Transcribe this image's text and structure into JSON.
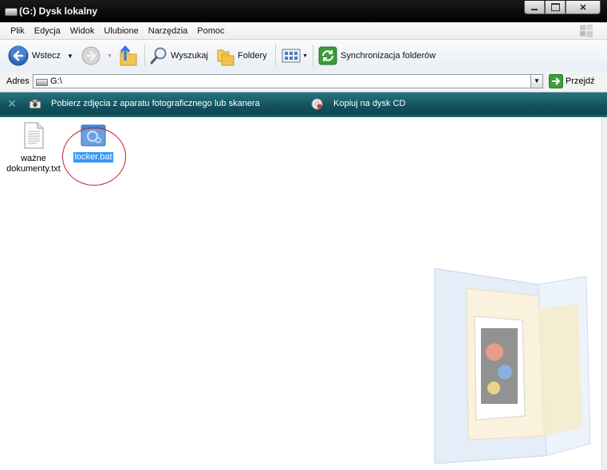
{
  "window": {
    "title": "(G:) Dysk lokalny"
  },
  "menu": {
    "items": [
      "Plik",
      "Edycja",
      "Widok",
      "Ulubione",
      "Narzędzia",
      "Pomoc"
    ]
  },
  "toolbar": {
    "back_label": "Wstecz",
    "search_label": "Wyszukaj",
    "folders_label": "Foldery",
    "sync_label": "Synchronizacja folderów"
  },
  "address": {
    "label": "Adres",
    "path": "G:\\",
    "go_label": "Przejdź"
  },
  "tasks": {
    "camera_label": "Pobierz zdjęcia z aparatu fotograficznego lub skanera",
    "cd_label": "Kopiuj na dysk CD"
  },
  "files": [
    {
      "name_line1": "ważne",
      "name_line2": "dokumenty.txt",
      "icon": "text-file-icon",
      "selected": false
    },
    {
      "name_line1": "locker.bat",
      "icon": "batch-file-icon",
      "selected": true
    }
  ],
  "colors": {
    "taskbar": "#12525e",
    "selection": "#3399ff",
    "annotation_circle": "#c0202a"
  }
}
